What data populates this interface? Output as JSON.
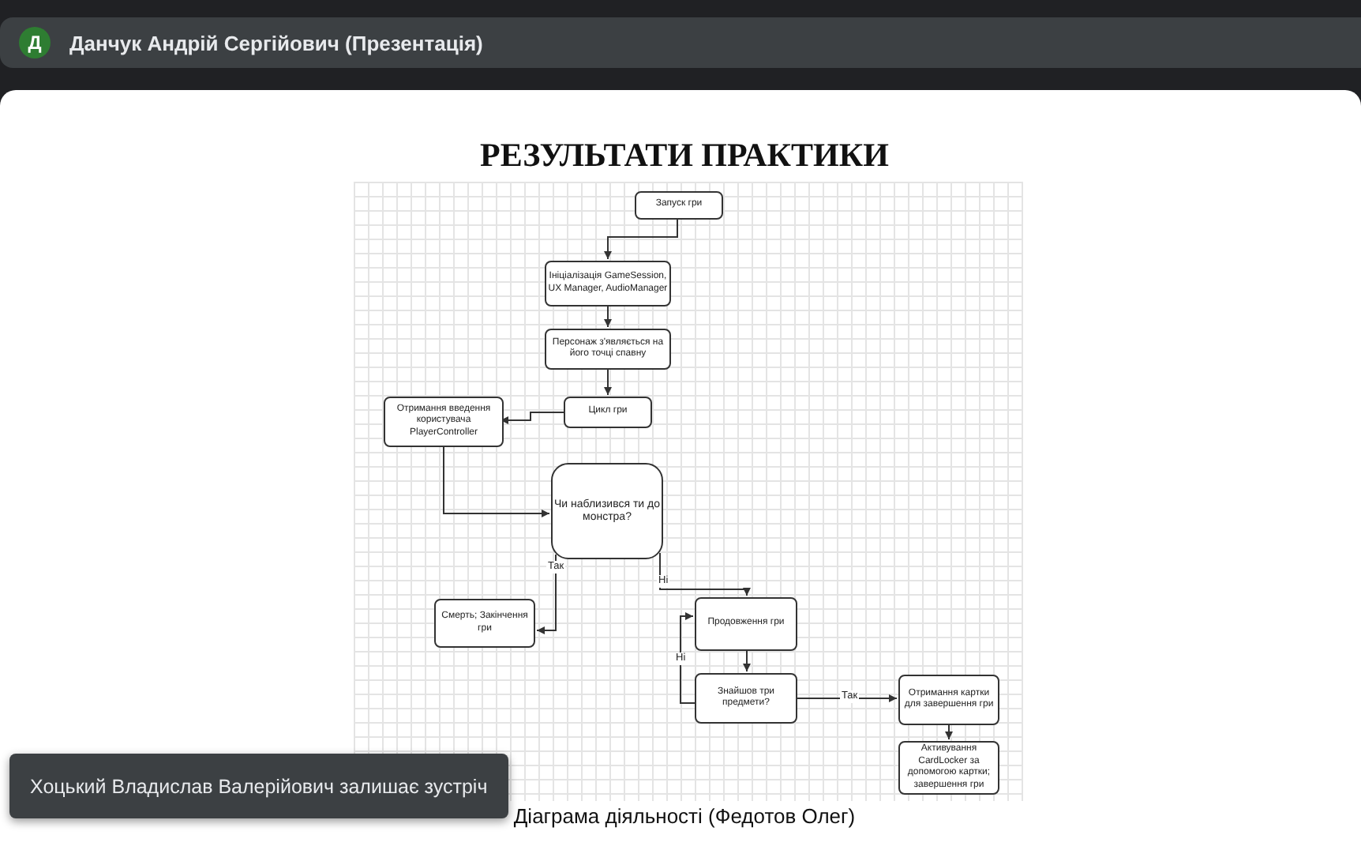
{
  "header": {
    "avatar_letter": "Д",
    "title": "Данчук Андрій Сергійович (Презентація)"
  },
  "slide": {
    "title": "РЕЗУЛЬТАТИ ПРАКТИКИ",
    "diagram": {
      "nodes": [
        {
          "kind": "process",
          "text": "Запуск гри"
        },
        {
          "kind": "process",
          "text": "Ініціалізація GameSession, UX Manager, AudioManager"
        },
        {
          "kind": "process",
          "text": "Персонаж з'являється на його точці спавну"
        },
        {
          "kind": "process",
          "text": "Цикл гри"
        },
        {
          "kind": "process",
          "text": "Отримання введення користувача PlayerController"
        },
        {
          "kind": "decision",
          "text": "Чи наблизився ти до монстра?"
        },
        {
          "kind": "process",
          "text": "Смерть; Закінчення гри"
        },
        {
          "kind": "process",
          "text": "Продовження гри"
        },
        {
          "kind": "process",
          "text": "Знайшов три предмети?"
        },
        {
          "kind": "process",
          "text": "Отримання картки для завершення гри"
        },
        {
          "kind": "process",
          "text": "Активування CardLocker за допомогою картки; завершення гри"
        }
      ],
      "edge_labels": [
        "Так",
        "Ні",
        "Ні",
        "Так"
      ]
    },
    "caption": "Діаграма діяльності (Федотов Олег)"
  },
  "toast": {
    "text": "Хоцький Владислав Валерійович залишає зустріч"
  }
}
